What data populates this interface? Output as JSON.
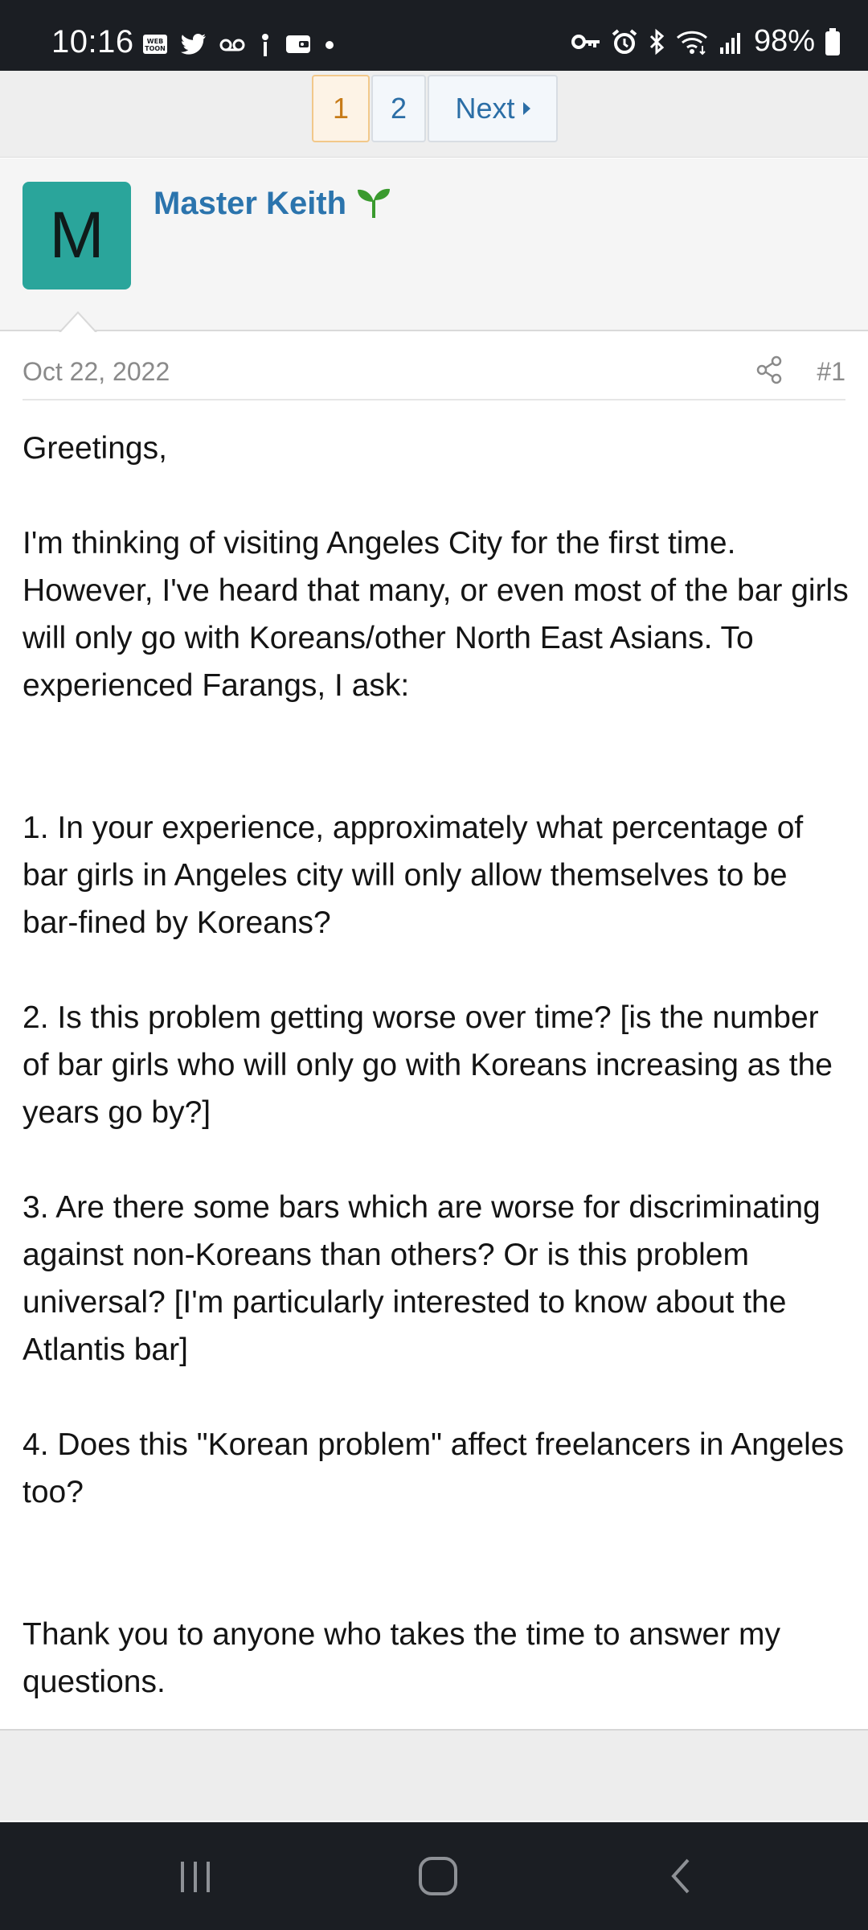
{
  "status_bar": {
    "time": "10:16",
    "left_icons": [
      "webtoon-icon",
      "twitter-icon",
      "voicemail-icon",
      "antenna-icon",
      "wallet-icon",
      "dot-icon"
    ],
    "right_icons": [
      "vpn-key-icon",
      "alarm-icon",
      "bluetooth-icon",
      "wifi-icon",
      "signal-icon",
      "battery-icon"
    ],
    "battery": "98%"
  },
  "pagination": {
    "pages": [
      "1",
      "2"
    ],
    "current": "1",
    "next_label": "Next"
  },
  "post": {
    "author": {
      "avatar_letter": "M",
      "avatar_color": "#2aa59b",
      "name": "Master Keith",
      "badge_icon": "sprout-icon"
    },
    "date": "Oct 22, 2022",
    "number": "#1",
    "body": {
      "greeting": "Greetings,",
      "intro": "I'm thinking of visiting Angeles City for the first time. However, I've heard that many, or even most of the bar girls will only go with Koreans/other North East Asians. To experienced Farangs, I ask:",
      "q1": "1. In your experience, approximately what percentage of bar girls in Angeles city will only allow themselves to be bar-fined by Koreans?",
      "q2": "2. Is this problem getting worse over time? [is the number of bar girls who will only go with Koreans increasing as the years go by?]",
      "q3": "3. Are there some bars which are worse for discriminating against non-Koreans than others? Or is this problem universal? [I'm particularly interested to know about the Atlantis bar]",
      "q4": "4. Does this \"Korean problem\" affect freelancers in Angeles too?",
      "thanks": "Thank you to anyone who takes the time to answer my questions."
    }
  },
  "colors": {
    "link": "#2b74ad",
    "current_page": "#c77b18",
    "system_bar": "#1b1e23"
  }
}
